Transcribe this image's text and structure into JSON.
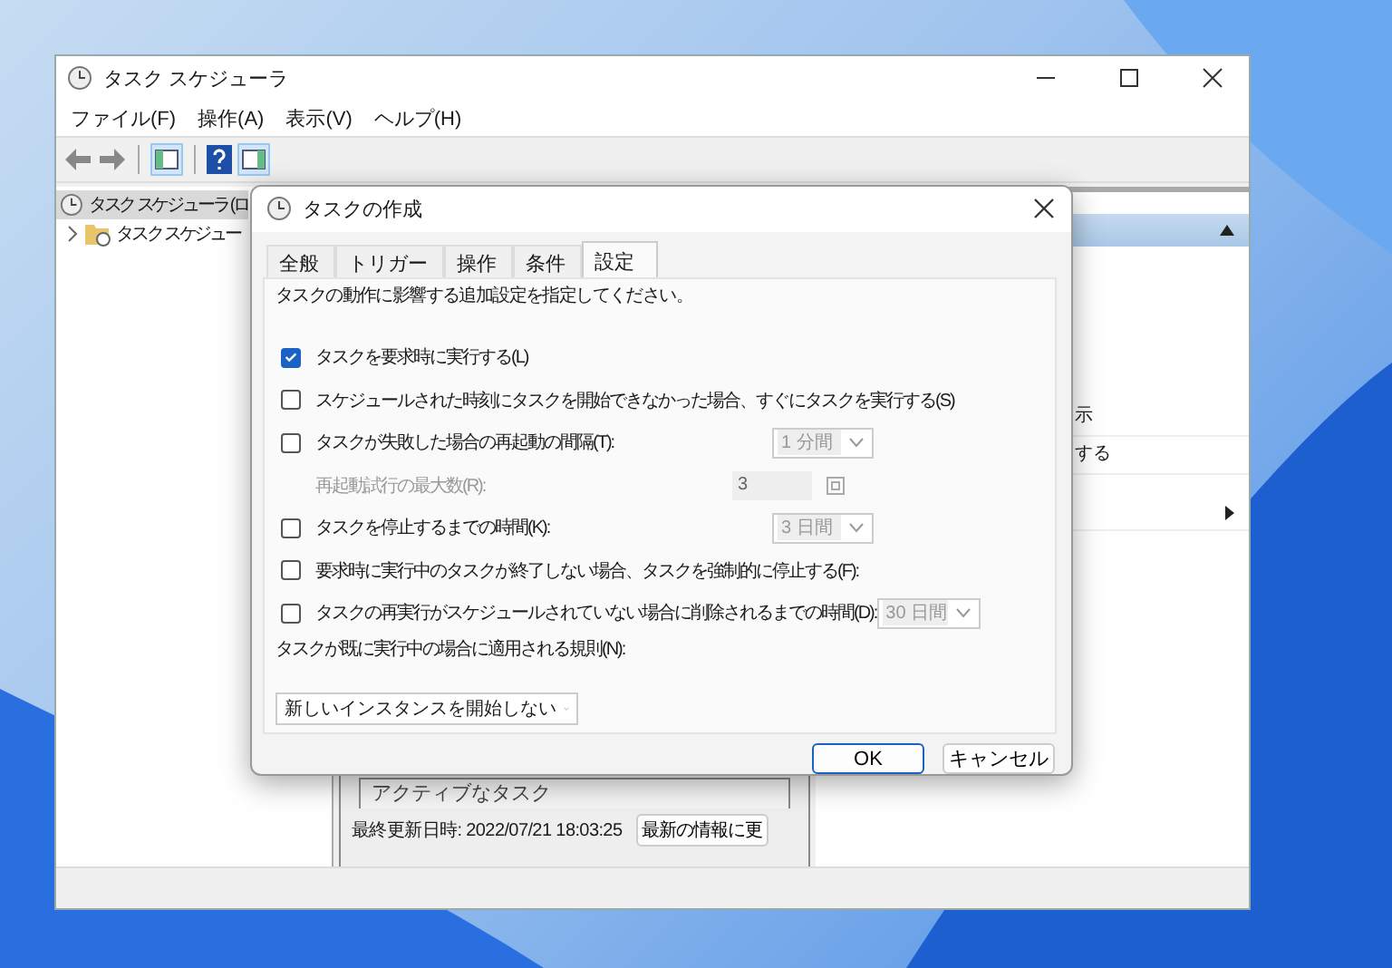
{
  "main_window": {
    "title": "タスク スケジューラ",
    "menu": [
      "ファイル(F)",
      "操作(A)",
      "表示(V)",
      "ヘルプ(H)"
    ],
    "tree": [
      {
        "label": "タスク スケジューラ (ロ",
        "selected": true,
        "children": [
          {
            "label": "タスク スケジュー",
            "expanded": false
          }
        ]
      }
    ],
    "middle": {
      "list_header": "アクティブなタスク",
      "status": "最終更新日時: 2022/07/21 18:03:25",
      "refresh_button": "最新の情報に更"
    },
    "actions": [
      "示",
      "する"
    ]
  },
  "dialog": {
    "title": "タスクの作成",
    "tabs": [
      {
        "label": "全般",
        "selected": false
      },
      {
        "label": "トリガー",
        "selected": false
      },
      {
        "label": "操作",
        "selected": false
      },
      {
        "label": "条件",
        "selected": false
      },
      {
        "label": "設定",
        "selected": true
      }
    ],
    "description": "タスクの動作に影響する追加設定を指定してください。",
    "settings": [
      {
        "kind": "checkbox",
        "label": "タスクを要求時に実行する(L)",
        "checked": true
      },
      {
        "kind": "checkbox",
        "label": "スケジュールされた時刻にタスクを開始できなかった場合、すぐにタスクを実行する(S)",
        "checked": false
      },
      {
        "kind": "checkbox",
        "label": "タスクが失敗した場合の再起動の間隔(T):",
        "checked": false,
        "dropdown": {
          "value": "1 分間",
          "disabled": true
        }
      },
      {
        "kind": "number",
        "label": "再起動試行の最大数(R):",
        "value": "3",
        "disabled": true
      },
      {
        "kind": "checkbox",
        "label": "タスクを停止するまでの時間(K):",
        "checked": false,
        "dropdown": {
          "value": "3 日間",
          "disabled": true
        }
      },
      {
        "kind": "checkbox",
        "label": "要求時に実行中のタスクが終了しない場合、タスクを強制的に停止する(F):",
        "checked": false
      },
      {
        "kind": "checkbox",
        "label": "タスクの再実行がスケジュールされていない場合に削除されるまでの時間(D):",
        "checked": false,
        "dropdown": {
          "value": "30 日間",
          "disabled": true
        }
      },
      {
        "kind": "label",
        "label": "タスクが既に実行中の場合に適用される規則(N):"
      },
      {
        "kind": "select",
        "value": "新しいインスタンスを開始しない"
      }
    ],
    "buttons": [
      {
        "label": "OK",
        "default": true
      },
      {
        "label": "キャンセル",
        "default": false
      }
    ]
  }
}
